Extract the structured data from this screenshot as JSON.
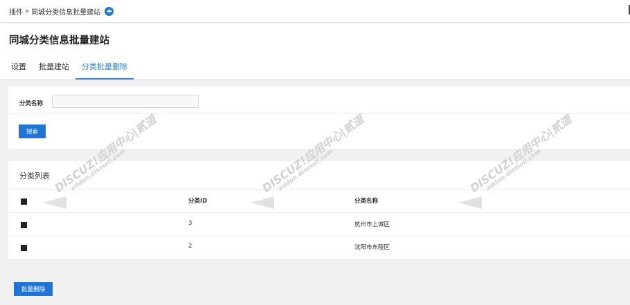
{
  "breadcrumb": {
    "root": "插件",
    "separator": "»",
    "current": "同城分类信息批量建站"
  },
  "page": {
    "title": "同城分类信息批量建站"
  },
  "tabs": [
    {
      "label": "设置",
      "active": false
    },
    {
      "label": "批量建站",
      "active": false
    },
    {
      "label": "分类批量删除",
      "active": true
    }
  ],
  "search": {
    "field_label": "分类名称",
    "field_value": "",
    "button_label": "搜索"
  },
  "list": {
    "title": "分类列表",
    "columns": [
      "",
      "分类ID",
      "分类名称"
    ],
    "rows": [
      {
        "id": "3",
        "name": "杭州市上城区"
      },
      {
        "id": "2",
        "name": "沈阳市东陵区"
      }
    ]
  },
  "actions": {
    "batch_delete_label": "批量删除"
  },
  "watermark": {
    "line1": "DISCUZ!应用中心|贰道",
    "line2": "addon.dismall.com"
  },
  "colors": {
    "accent": "#1f74d6",
    "active_tab": "#2f83e0",
    "background": "#f1f1f1"
  }
}
